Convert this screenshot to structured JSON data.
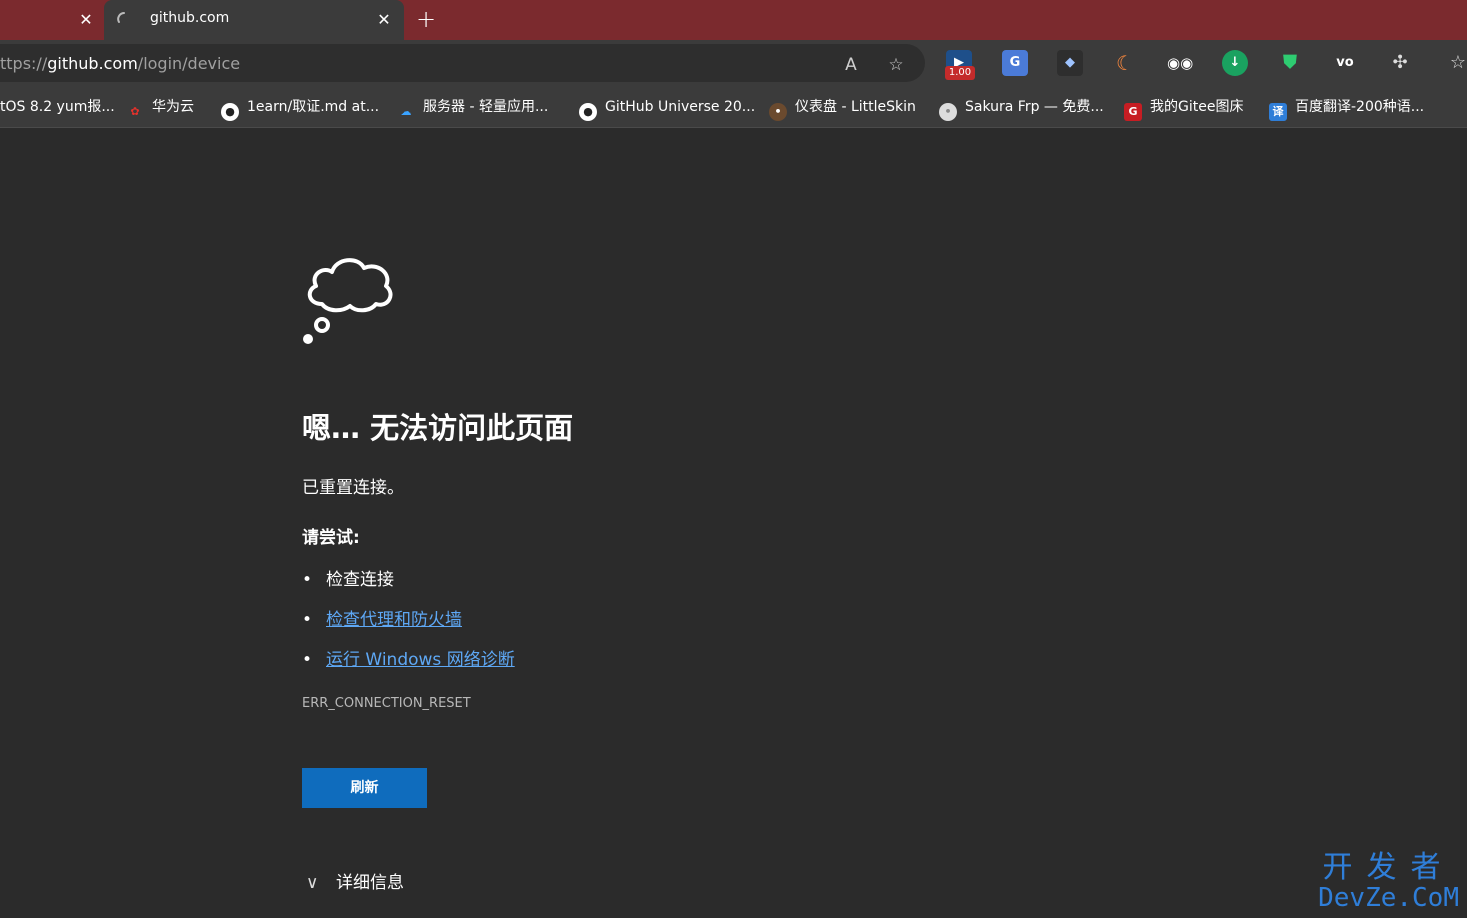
{
  "tabs": {
    "prev_close": "✕",
    "active_title": "github.com",
    "active_close": "✕",
    "new_tab": "+"
  },
  "address": {
    "scheme_fragment": "ttps://",
    "host": "github.com",
    "path": "/login/device"
  },
  "toolbar": {
    "read_aloud_label": "A",
    "extension_badge": "1.00"
  },
  "bookmarks": [
    {
      "label": "tOS 8.2 yum报..."
    },
    {
      "label": "华为云"
    },
    {
      "label": "1earn/取证.md at..."
    },
    {
      "label": "服务器 - 轻量应用..."
    },
    {
      "label": "GitHub Universe 20..."
    },
    {
      "label": "仪表盘 - LittleSkin"
    },
    {
      "label": "Sakura Frp — 免费..."
    },
    {
      "label": "我的Gitee图床"
    },
    {
      "label": "百度翻译-200种语..."
    }
  ],
  "error_page": {
    "heading": "嗯… 无法访问此页面",
    "message": "已重置连接。",
    "try_label": "请尝试:",
    "suggestions": [
      {
        "text": "检查连接",
        "link": false
      },
      {
        "text": "检查代理和防火墙",
        "link": true
      },
      {
        "text": "运行 Windows 网络诊断",
        "link": true
      }
    ],
    "error_code": "ERR_CONNECTION_RESET",
    "refresh_button": "刷新",
    "details_label": "详细信息"
  },
  "watermark": {
    "line1": "开发者",
    "line2": "DevZe.CoM"
  },
  "colors": {
    "tabstrip": "#7b2a2e",
    "toolbar": "#3b3b3b",
    "page_bg": "#2b2b2b",
    "link": "#5ea8f5",
    "button": "#0f6cbd",
    "watermark": "#2f7ed8"
  }
}
